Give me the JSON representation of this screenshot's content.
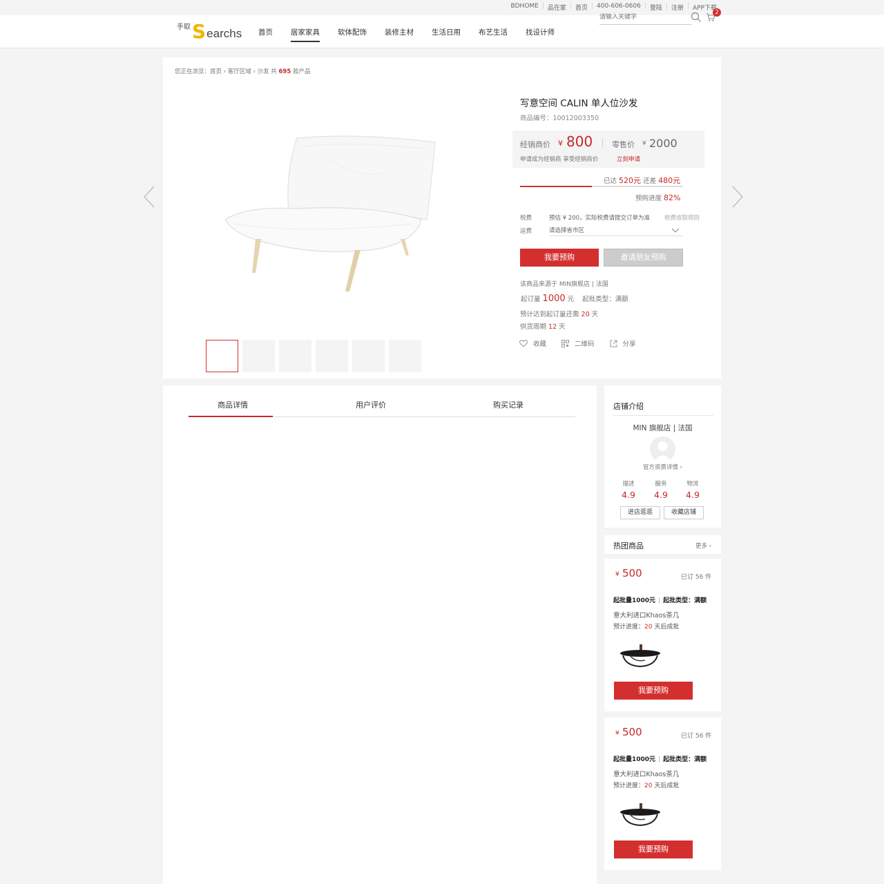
{
  "topbar": {
    "links": [
      "BDHOME",
      "品在家",
      "首页",
      "400-606-0606",
      "登陆",
      "注册",
      "APP下载"
    ]
  },
  "header": {
    "logo_cn": "手取",
    "logo_s": "S",
    "logo_rest": "earchs",
    "nav": [
      "首页",
      "居家家具",
      "软体配饰",
      "装修主材",
      "生活日用",
      "布艺生活",
      "找设计师"
    ],
    "nav_active_index": 1,
    "search_placeholder": "请输入关键字",
    "cart_count": "2"
  },
  "breadcrumb": {
    "prefix": "您正在浏览：首页 › 客厅区域 › 沙发  共",
    "count": "695",
    "suffix": "款产品"
  },
  "product": {
    "title": "写意空间 CALIN 单人位沙发",
    "code": "商品编号：10012003350",
    "dealer_label": "经销商价",
    "dealer_currency": "¥",
    "dealer_price": "800",
    "retail_label": "零售价",
    "retail_currency": "¥",
    "retail_price": "2000",
    "dealer_note": "申请成为经销商 享受经销商价",
    "apply_link": "立刻申请",
    "reached_label": "已达",
    "reached_value": "520元",
    "remain_label": "还差",
    "remain_value": "480元",
    "progress_label": "预购进度",
    "progress_value": "82%",
    "progress_fraction": 0.44,
    "tax_label": "税费",
    "tax_text": "预估 ¥ 200，实际税费请提交订单为准",
    "tax_rule": "税费收取规则",
    "ship_label": "运费",
    "ship_placeholder": "请选择省市区",
    "preorder_button": "我要预购",
    "invite_button": "邀请朋友预购",
    "source": "该商品来源于  MIN旗舰店 | 法国",
    "moq_label": "起订量",
    "moq_value": "1000",
    "moq_unit": "元",
    "batch_type": "起批类型：满额",
    "eta_label": "预计达到起订量还需",
    "eta_value": "20",
    "eta_unit": "天",
    "cycle_label": "供货周期",
    "cycle_value": "12",
    "cycle_unit": "天",
    "action_favorite": "收藏",
    "action_qrcode": "二维码",
    "action_share": "分享"
  },
  "tabs": [
    "商品详情",
    "用户评价",
    "购买记录"
  ],
  "shop": {
    "title": "店铺介绍",
    "name": "MIN 旗舰店 | 法国",
    "qualification": "官方资质详情 ›",
    "ratings": [
      {
        "label": "描述",
        "value": "4.9"
      },
      {
        "label": "服务",
        "value": "4.9"
      },
      {
        "label": "物流",
        "value": "4.9"
      }
    ],
    "enter_button": "进店逛逛",
    "fav_button": "收藏店铺"
  },
  "hot": {
    "title": "热团商品",
    "more": "更多 ›",
    "items": [
      {
        "currency": "¥",
        "price": "500",
        "sold": "已订 56 件",
        "meta_a": "起批量1000元",
        "meta_b": "起批类型：满额",
        "name": "意大利进口Khaos茶几",
        "progress_label": "预计进度：",
        "progress_value": "20",
        "progress_suffix": "天后成批",
        "button": "我要预购"
      },
      {
        "currency": "¥",
        "price": "500",
        "sold": "已订 56 件",
        "meta_a": "起批量1000元",
        "meta_b": "起批类型：满额",
        "name": "意大利进口Khaos茶几",
        "progress_label": "预计进度：",
        "progress_value": "20",
        "progress_suffix": "天后成批",
        "button": "我要预购"
      }
    ]
  },
  "colors": {
    "accent": "#d32f2f",
    "price_red": "#c62828",
    "page_bg": "#f4f4f4"
  },
  "icons": {
    "search": "search-icon",
    "cart": "cart-icon",
    "prev": "chevron-left-icon",
    "next": "chevron-right-icon",
    "heart": "heart-icon",
    "qrcode": "qrcode-icon",
    "share": "share-icon"
  }
}
